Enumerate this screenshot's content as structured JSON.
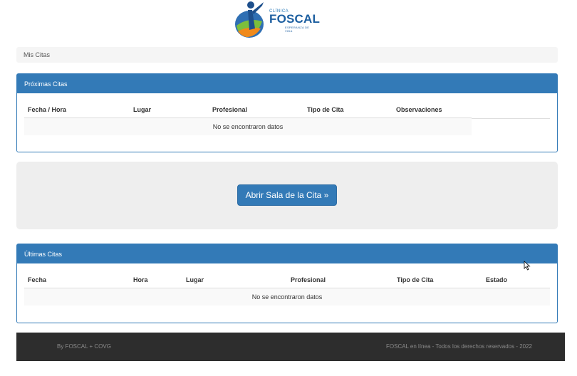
{
  "logo": {
    "clinica": "CLÍNICA",
    "name": "FOSCAL",
    "tagline": "ESPERANZA DE VIDA"
  },
  "breadcrumb": "Mis Citas",
  "upcoming": {
    "title": "Próximas Citas",
    "columns": [
      "Fecha / Hora",
      "Lugar",
      "Profesional",
      "Tipo de Cita",
      "Observaciones"
    ],
    "empty_text": "No se encontraron datos"
  },
  "open_room_button": "Abrir Sala de la Cita »",
  "past": {
    "title": "Últimas Citas",
    "columns": [
      "Fecha",
      "Hora",
      "Lugar",
      "Profesional",
      "Tipo de Cita",
      "Estado"
    ],
    "empty_text": "No se encontraron datos"
  },
  "footer": {
    "left": "By FOSCAL + COVG",
    "right": "FOSCAL en línea - Todos los derechos reservados - 2022"
  },
  "colors": {
    "primary": "#337ab7",
    "footer_bg": "#2d2d2d",
    "well_bg": "#eeeeee"
  }
}
